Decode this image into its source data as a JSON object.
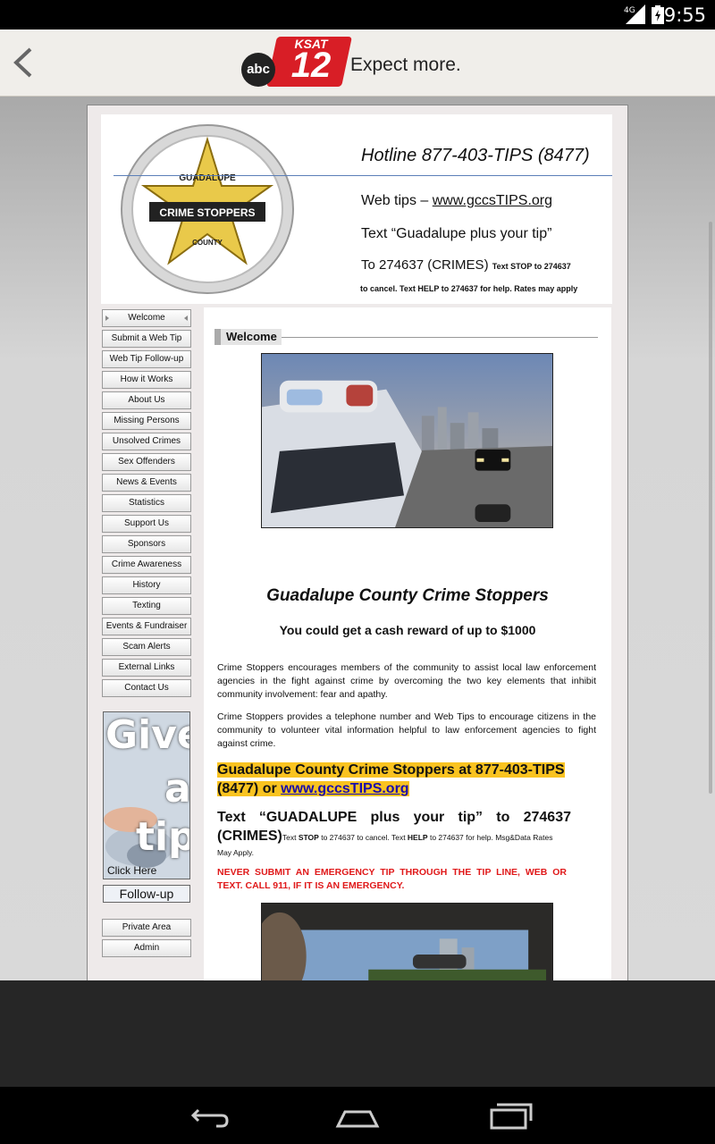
{
  "status_bar": {
    "time": "9:55",
    "network": "4G",
    "icons": [
      "signal-icon",
      "battery-icon"
    ]
  },
  "app_bar": {
    "back_icon": "chevron-left-icon",
    "logo": {
      "network": "abc",
      "station": "KSAT",
      "channel": "12",
      "tagline": "Expect more."
    }
  },
  "banner": {
    "seal": {
      "top_text": "GUADALUPE",
      "ribbon": "CRIME STOPPERS",
      "bottom_text": "COUNTY"
    },
    "hotline": "Hotline 877-403-TIPS (8477)",
    "web_tips_prefix": "Web tips – ",
    "web_tips_url": "www.gccsTIPS.org",
    "text_line": "Text “Guadalupe plus your tip”",
    "to_line": "To 274637 (CRIMES)",
    "to_small": "Text STOP to 274637",
    "small_line": "to cancel. Text HELP to 274637 for help. Rates may apply"
  },
  "nav": {
    "items": [
      {
        "label": "Welcome"
      },
      {
        "label": "Submit a Web Tip"
      },
      {
        "label": "Web Tip Follow-up"
      },
      {
        "label": "How it Works"
      },
      {
        "label": "About Us"
      },
      {
        "label": "Missing Persons"
      },
      {
        "label": "Unsolved Crimes"
      },
      {
        "label": "Sex Offenders"
      },
      {
        "label": "News & Events"
      },
      {
        "label": "Statistics"
      },
      {
        "label": "Support Us"
      },
      {
        "label": "Sponsors"
      },
      {
        "label": "Crime Awareness"
      },
      {
        "label": "History"
      },
      {
        "label": "Texting"
      },
      {
        "label": "Events & Fundraiser"
      },
      {
        "label": "Scam Alerts"
      },
      {
        "label": "External Links"
      },
      {
        "label": "Contact Us"
      }
    ],
    "give_tip": {
      "word1": "Give",
      "word2": "a",
      "word3": "tip",
      "click": "Click Here",
      "followup": "Follow-up"
    },
    "bottom_items": [
      {
        "label": "Private Area"
      },
      {
        "label": "Admin"
      }
    ]
  },
  "content": {
    "section_title": "Welcome",
    "heading": "Guadalupe County Crime Stoppers",
    "reward": "You could get a cash reward of up to $1000",
    "para1": "Crime Stoppers encourages members of the community to assist local law enforcement agencies in the fight against crime by overcoming the two key elements that inhibit community involvement: fear and apathy.",
    "para2": "Crime Stoppers provides a telephone number and Web Tips to encourage citizens in the community to volunteer vital information helpful to law enforcement agencies to fight against crime.",
    "highlight_text": "Guadalupe County Crime Stoppers at 877-403-TIPS (8477) or ",
    "highlight_link": "www.gccsTIPS.org",
    "text_big": "Text “GUADALUPE plus your tip” to 274637 (CRIMES)",
    "text_small_1": "Text ",
    "text_small_stop": "STOP",
    "text_small_2": " to 274637 to cancel. Text ",
    "text_small_help": "HELP",
    "text_small_3": " to 274637 for help. Msg&Data Rates",
    "text_small_4": "May Apply.",
    "warning": "NEVER SUBMIT AN EMERGENCY TIP THROUGH THE TIP LINE, WEB OR TEXT. CALL 911, IF IT IS AN EMERGENCY."
  },
  "system_nav": {
    "icons": [
      "back-icon",
      "home-icon",
      "recent-apps-icon"
    ]
  },
  "colors": {
    "highlight": "#f9c320",
    "warning": "#e0191a",
    "link": "#1a0dab",
    "ksat_red": "#d81e26"
  }
}
